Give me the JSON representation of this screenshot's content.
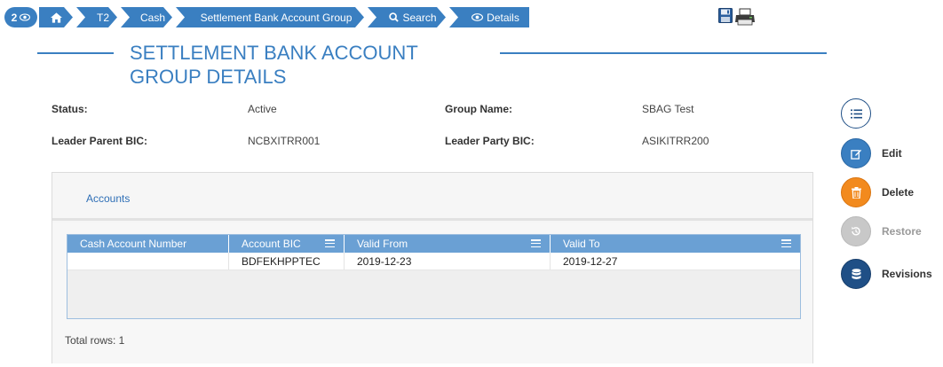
{
  "breadcrumb": {
    "counter": "2",
    "items": [
      {
        "label": ""
      },
      {
        "label": "T2"
      },
      {
        "label": "Cash"
      },
      {
        "label": "Settlement Bank Account Group"
      },
      {
        "label": "Search"
      },
      {
        "label": "Details"
      }
    ]
  },
  "page": {
    "title": "Settlement Bank Account Group Details"
  },
  "details": {
    "status_label": "Status:",
    "status_value": "Active",
    "group_name_label": "Group Name:",
    "group_name_value": "SBAG Test",
    "leader_parent_bic_label": "Leader Parent BIC:",
    "leader_parent_bic_value": "NCBXITRR001",
    "leader_party_bic_label": "Leader Party BIC:",
    "leader_party_bic_value": "ASIKITRR200"
  },
  "accounts": {
    "panel_title": "Accounts",
    "columns": [
      "Cash Account Number",
      "Account BIC",
      "Valid From",
      "Valid To"
    ],
    "rows": [
      {
        "cash_account_number": "",
        "account_bic": "BDFEKHPPTEC",
        "valid_from": "2019-12-23",
        "valid_to": "2019-12-27"
      }
    ],
    "total_rows": "Total rows: 1"
  },
  "actions": {
    "edit": "Edit",
    "delete": "Delete",
    "restore": "Restore",
    "revisions": "Revisions"
  },
  "colors": {
    "primary": "#3a7fc1",
    "navy": "#1f4f86",
    "orange": "#f28a1e",
    "disabled": "#c8c8c8",
    "grid_header": "#6aa0d4"
  }
}
